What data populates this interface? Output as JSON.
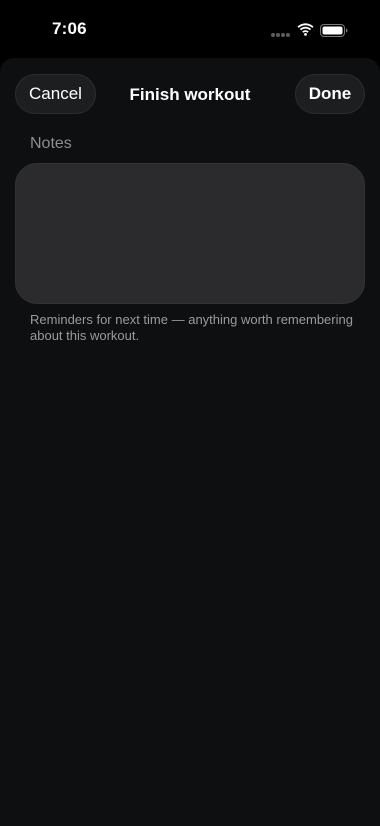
{
  "status_bar": {
    "time": "7:06",
    "icons": [
      "signal-dots-icon",
      "wifi-icon",
      "battery-icon"
    ]
  },
  "sheet": {
    "title": "Finish workout",
    "cancel_label": "Cancel",
    "done_label": "Done"
  },
  "notes": {
    "section_label": "Notes",
    "value": "",
    "helper": "Reminders for next time — anything worth remembering about this workout."
  },
  "colors": {
    "background": "#000000",
    "sheet": "#0e0f11",
    "button_bg": "#1d1e20",
    "field_bg": "#2b2b2d",
    "label": "#8d8d92",
    "helper": "#9a9a9f"
  }
}
